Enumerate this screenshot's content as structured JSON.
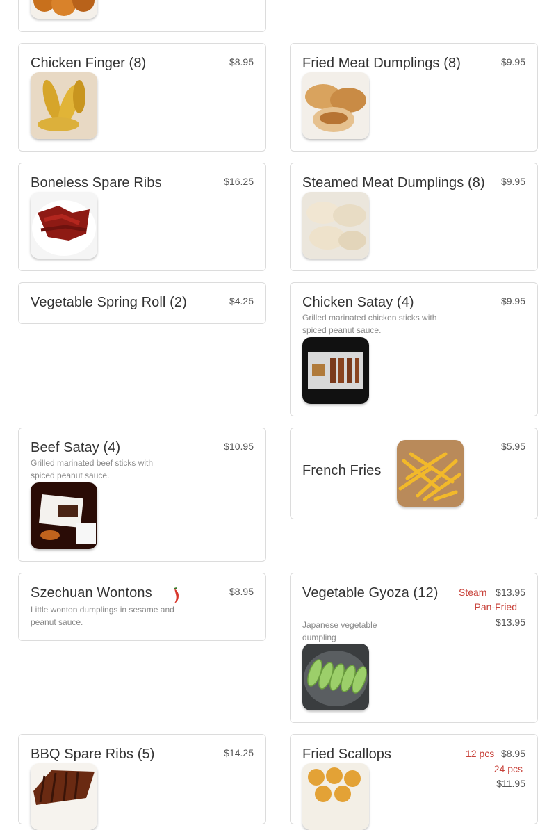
{
  "menu": {
    "items": [
      {
        "name": "Chicken Finger (8)",
        "price": "$8.95"
      },
      {
        "name": "Fried Meat Dumplings (8)",
        "price": "$9.95"
      },
      {
        "name": "Boneless Spare Ribs",
        "price": "$16.25"
      },
      {
        "name": "Steamed Meat Dumplings (8)",
        "price": "$9.95"
      },
      {
        "name": "Vegetable Spring Roll (2)",
        "price": "$4.25"
      },
      {
        "name": "Chicken Satay (4)",
        "price": "$9.95",
        "description": "Grilled marinated chicken sticks with spiced peanut sauce."
      },
      {
        "name": "Beef Satay (4)",
        "price": "$10.95",
        "description": "Grilled marinated beef sticks with spiced peanut sauce."
      },
      {
        "name": "French Fries",
        "price": "$5.95"
      },
      {
        "name": "Szechuan Wontons",
        "price": "$8.95",
        "description": "Little wonton dumplings in sesame and peanut sauce.",
        "spicy": true,
        "icon": "chili-pepper-icon"
      },
      {
        "name": "Vegetable Gyoza (12)",
        "description": "Japanese vegetable dumpling",
        "options": [
          {
            "label": "Steam",
            "price": "$13.95"
          },
          {
            "label": "Pan-Fried",
            "price": "$13.95"
          }
        ]
      },
      {
        "name": "BBQ Spare Ribs (5)",
        "price": "$14.25"
      },
      {
        "name": "Fried Scallops",
        "options": [
          {
            "label": "12 pcs",
            "price": "$8.95"
          },
          {
            "label": "24 pcs",
            "price": "$11.95"
          }
        ]
      }
    ]
  },
  "colors": {
    "option_label": "#c8423a",
    "border": "#dcdcdc",
    "name_text": "#333333",
    "desc_text": "#888888"
  }
}
